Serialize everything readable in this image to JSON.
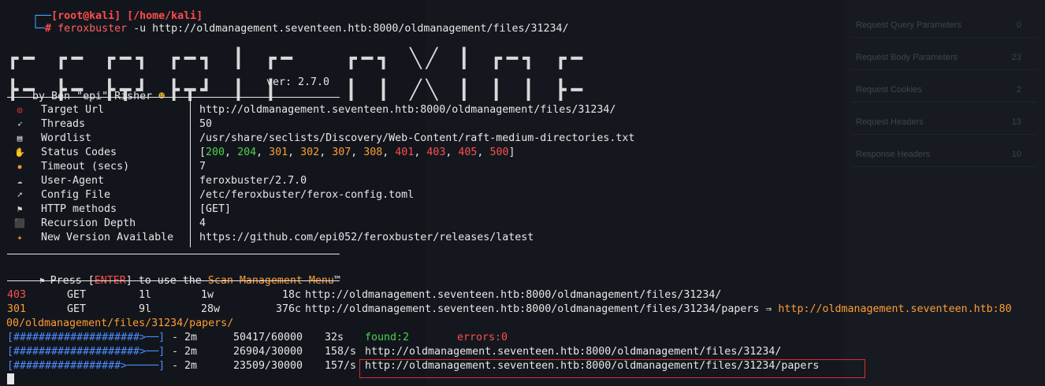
{
  "prompt": {
    "header": "[root@kali] [/home/kali]",
    "command": "feroxbuster",
    "args": " -u http://oldmanagement.seventeen.htb:8000/oldmanagement/files/31234/"
  },
  "banner": {
    "byline": "by Ben \"epi\" Risher ",
    "version": "ver: 2.7.0"
  },
  "config": [
    {
      "icon": "target-icon",
      "glyph": "◎",
      "color": "#ff3b3b",
      "key": "Target Url",
      "value": "http://oldmanagement.seventeen.htb:8000/oldmanagement/files/31234/"
    },
    {
      "icon": "threads-icon",
      "glyph": "➶",
      "color": "#d9d9d9",
      "key": "Threads",
      "value": "50"
    },
    {
      "icon": "wordlist-icon",
      "glyph": "▤",
      "color": "#e6e6e6",
      "key": "Wordlist",
      "value": "/usr/share/seclists/Discovery/Web-Content/raft-medium-directories.txt"
    },
    {
      "icon": "status-icon",
      "glyph": "✋",
      "color": "#f0b429",
      "key": "Status Codes",
      "value": ""
    },
    {
      "icon": "timeout-icon",
      "glyph": "✸",
      "color": "#ff9c33",
      "key": "Timeout (secs)",
      "value": "7"
    },
    {
      "icon": "useragent-icon",
      "glyph": "☁",
      "color": "#bfbfbf",
      "key": "User-Agent",
      "value": "feroxbuster/2.7.0"
    },
    {
      "icon": "config-icon",
      "glyph": "➚",
      "color": "#d9d9d9",
      "key": "Config File",
      "value": "/etc/feroxbuster/ferox-config.toml"
    },
    {
      "icon": "methods-icon",
      "glyph": "⚑",
      "color": "#d9d9d9",
      "key": "HTTP methods",
      "value": "[GET]"
    },
    {
      "icon": "recursion-icon",
      "glyph": "⬛",
      "color": "#3b7dd8",
      "key": "Recursion Depth",
      "value": "4"
    },
    {
      "icon": "party-icon",
      "glyph": "✦",
      "color": "#ff9c33",
      "key": "New Version Available",
      "value": "https://github.com/epi052/feroxbuster/releases/latest"
    }
  ],
  "status_codes": [
    {
      "code": "200",
      "color": "#4fd14f"
    },
    {
      "code": "204",
      "color": "#4fd14f"
    },
    {
      "code": "301",
      "color": "#ff9c33"
    },
    {
      "code": "302",
      "color": "#ff9c33"
    },
    {
      "code": "307",
      "color": "#ff9c33"
    },
    {
      "code": "308",
      "color": "#ff9c33"
    },
    {
      "code": "401",
      "color": "#ff4d4d"
    },
    {
      "code": "403",
      "color": "#ff4d4d"
    },
    {
      "code": "405",
      "color": "#ff4d4d"
    },
    {
      "code": "500",
      "color": "#ff4d4d"
    }
  ],
  "scan_menu": {
    "pre": "Press [",
    "key": "ENTER",
    "mid": "] to use the ",
    "menu": "Scan Management Menu",
    "tm": "™"
  },
  "results": [
    {
      "status": "403",
      "status_color": "#ff4d4d",
      "method": "GET",
      "lines": "1l",
      "words": "1w",
      "chars": "18c",
      "url": "http://oldmanagement.seventeen.htb:8000/oldmanagement/files/31234/",
      "arrow": "",
      "redirect": ""
    },
    {
      "status": "301",
      "status_color": "#ff9c33",
      "method": "GET",
      "lines": "9l",
      "words": "28w",
      "chars": "376c",
      "url": "http://oldmanagement.seventeen.htb:8000/oldmanagement/files/31234/papers",
      "arrow": " ⇒ ",
      "redirect": "http://oldmanagement.seventeen.htb:80"
    }
  ],
  "redirect_wrap": "00/oldmanagement/files/31234/papers/",
  "progress": [
    {
      "bar": "[####################>--]",
      "time": "- 2m",
      "count": "50417/60000",
      "rate": "32s",
      "extra_a": "found:2",
      "extra_b": "errors:0",
      "url": ""
    },
    {
      "bar": "[####################>--]",
      "time": "- 2m",
      "count": "26904/30000",
      "rate": "158/s",
      "extra_a": "",
      "extra_b": "",
      "url": "http://oldmanagement.seventeen.htb:8000/oldmanagement/files/31234/"
    },
    {
      "bar": "[#################>-----]",
      "time": "- 2m",
      "count": "23509/30000",
      "rate": "157/s",
      "extra_a": "",
      "extra_b": "",
      "url": "http://oldmanagement.seventeen.htb:8000/oldmanagement/files/31234/papers"
    }
  ],
  "inspector": [
    {
      "label": "Request Query Parameters",
      "count": "0"
    },
    {
      "label": "Request Body Parameters",
      "count": "23"
    },
    {
      "label": "Request Cookies",
      "count": "2"
    },
    {
      "label": "Request Headers",
      "count": "13"
    },
    {
      "label": "Response Headers",
      "count": "10"
    }
  ]
}
